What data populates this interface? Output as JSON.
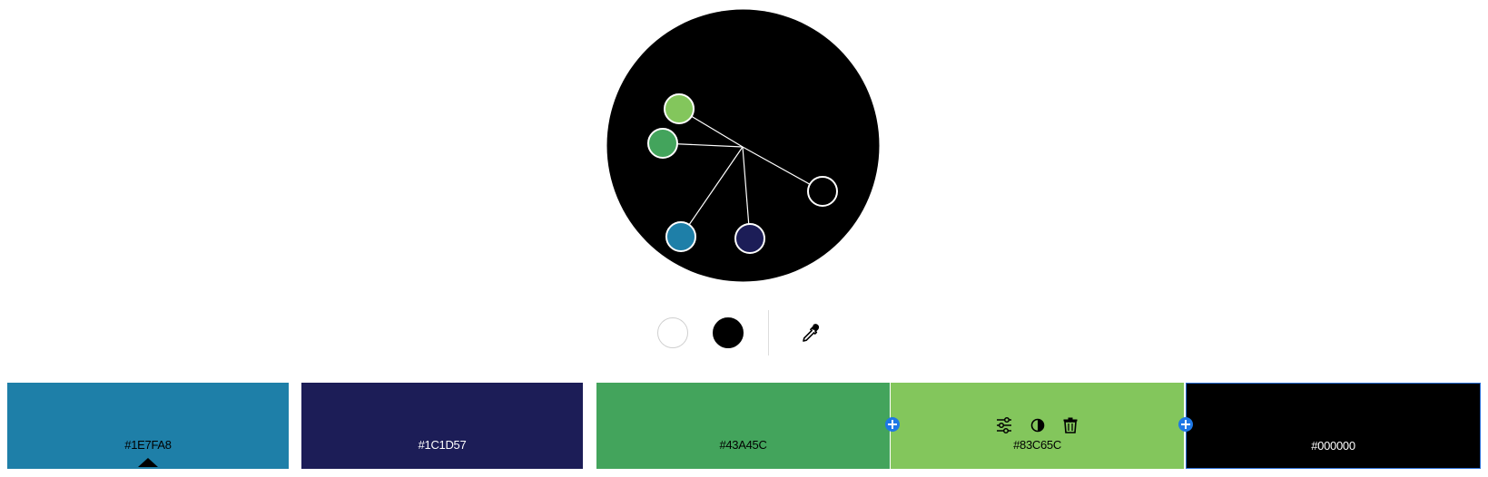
{
  "colors": {
    "white": "#FFFFFF",
    "black": "#000000",
    "accent_plus": "#1E78E6"
  },
  "wheel": {
    "background": "#000000",
    "handles": [
      {
        "name": "handle-83C65C",
        "color": "#83C65C"
      },
      {
        "name": "handle-43A45C",
        "color": "#43A45C"
      },
      {
        "name": "handle-000000",
        "color": "#000000"
      },
      {
        "name": "handle-1E7FA8",
        "color": "#1E7FA8"
      },
      {
        "name": "handle-1C1D57",
        "color": "#1C1D57"
      }
    ]
  },
  "tools": {
    "white_swatch": "white-swatch",
    "black_swatch": "black-swatch",
    "eyedropper": "eyedropper-icon"
  },
  "palette": [
    {
      "hex": "#1E7FA8",
      "text_color": "#000000",
      "selected": true
    },
    {
      "hex": "#1C1D57",
      "text_color": "#FFFFFF",
      "selected": false
    },
    {
      "hex": "#43A45C",
      "text_color": "#000000",
      "selected": false
    },
    {
      "hex": "#83C65C",
      "text_color": "#000000",
      "selected": false,
      "actions": [
        "sliders-icon",
        "contrast-icon",
        "trash-icon"
      ]
    },
    {
      "hex": "#000000",
      "text_color": "#FFFFFF",
      "selected": false
    }
  ]
}
